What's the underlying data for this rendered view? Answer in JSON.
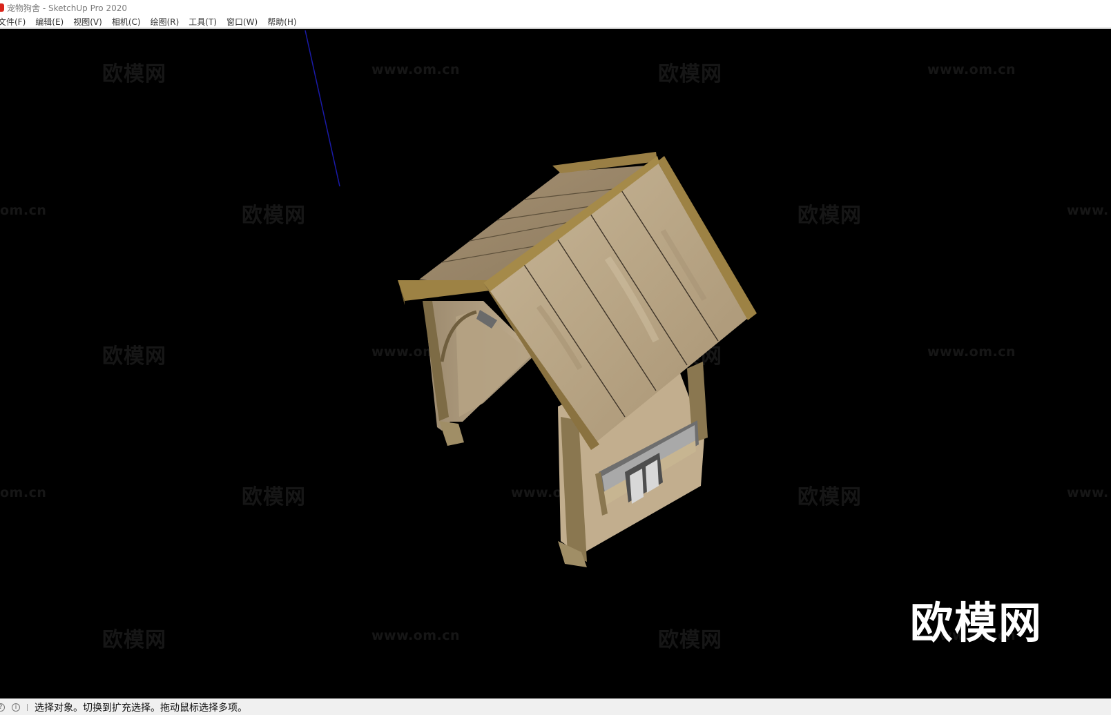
{
  "window": {
    "title": "宠物狗舍 - SketchUp Pro 2020",
    "accent_color": "#d9251c"
  },
  "menubar": {
    "items": [
      {
        "name": "menu-file",
        "label": "文件(F)"
      },
      {
        "name": "menu-edit",
        "label": "编辑(E)"
      },
      {
        "name": "menu-view",
        "label": "视图(V)"
      },
      {
        "name": "menu-camera",
        "label": "相机(C)"
      },
      {
        "name": "menu-draw",
        "label": "绘图(R)"
      },
      {
        "name": "menu-tools",
        "label": "工具(T)"
      },
      {
        "name": "menu-window",
        "label": "窗口(W)"
      },
      {
        "name": "menu-help",
        "label": "帮助(H)"
      }
    ]
  },
  "viewport": {
    "background": "#000000",
    "model": "dog-house",
    "watermark_logo": "欧模网",
    "watermark_url": "www.om.cn",
    "watermark_url_partial_right": "www.",
    "watermark_url_partial_left": "om.cn"
  },
  "statusbar": {
    "icon_1": "help-icon",
    "icon_2": "info-icon",
    "message": "选择对象。切换到扩充选择。拖动鼠标选择多项。"
  }
}
